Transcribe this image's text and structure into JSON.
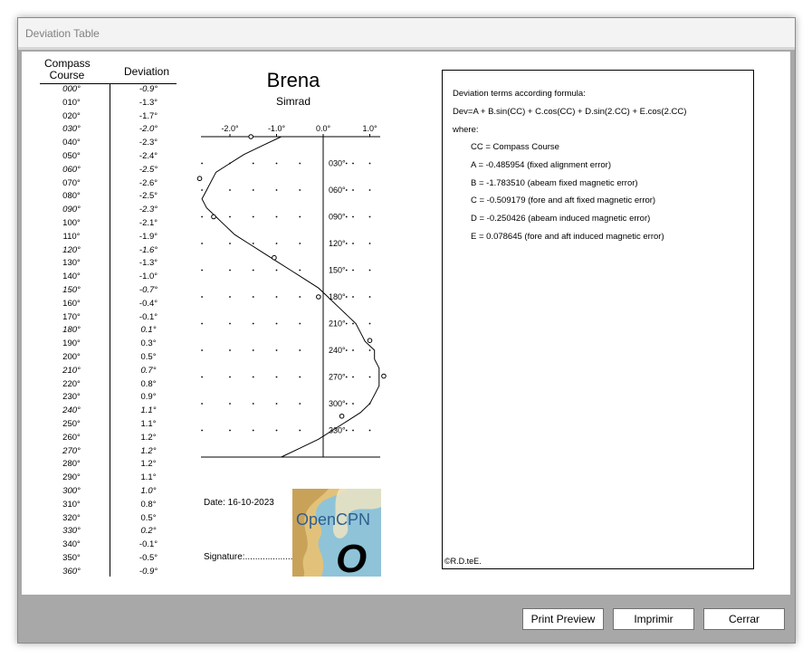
{
  "window": {
    "title": "Deviation Table"
  },
  "table": {
    "header_course": "Compass Course",
    "header_deviation": "Deviation",
    "rows": [
      {
        "cc": "000°",
        "dev": "-0.9°",
        "italic": true
      },
      {
        "cc": "010°",
        "dev": "-1.3°",
        "italic": false
      },
      {
        "cc": "020°",
        "dev": "-1.7°",
        "italic": false
      },
      {
        "cc": "030°",
        "dev": "-2.0°",
        "italic": true
      },
      {
        "cc": "040°",
        "dev": "-2.3°",
        "italic": false
      },
      {
        "cc": "050°",
        "dev": "-2.4°",
        "italic": false
      },
      {
        "cc": "060°",
        "dev": "-2.5°",
        "italic": true
      },
      {
        "cc": "070°",
        "dev": "-2.6°",
        "italic": false
      },
      {
        "cc": "080°",
        "dev": "-2.5°",
        "italic": false
      },
      {
        "cc": "090°",
        "dev": "-2.3°",
        "italic": true
      },
      {
        "cc": "100°",
        "dev": "-2.1°",
        "italic": false
      },
      {
        "cc": "110°",
        "dev": "-1.9°",
        "italic": false
      },
      {
        "cc": "120°",
        "dev": "-1.6°",
        "italic": true
      },
      {
        "cc": "130°",
        "dev": "-1.3°",
        "italic": false
      },
      {
        "cc": "140°",
        "dev": "-1.0°",
        "italic": false
      },
      {
        "cc": "150°",
        "dev": "-0.7°",
        "italic": true
      },
      {
        "cc": "160°",
        "dev": "-0.4°",
        "italic": false
      },
      {
        "cc": "170°",
        "dev": "-0.1°",
        "italic": false
      },
      {
        "cc": "180°",
        "dev": "0.1°",
        "italic": true
      },
      {
        "cc": "190°",
        "dev": "0.3°",
        "italic": false
      },
      {
        "cc": "200°",
        "dev": "0.5°",
        "italic": false
      },
      {
        "cc": "210°",
        "dev": "0.7°",
        "italic": true
      },
      {
        "cc": "220°",
        "dev": "0.8°",
        "italic": false
      },
      {
        "cc": "230°",
        "dev": "0.9°",
        "italic": false
      },
      {
        "cc": "240°",
        "dev": "1.1°",
        "italic": true
      },
      {
        "cc": "250°",
        "dev": "1.1°",
        "italic": false
      },
      {
        "cc": "260°",
        "dev": "1.2°",
        "italic": false
      },
      {
        "cc": "270°",
        "dev": "1.2°",
        "italic": true
      },
      {
        "cc": "280°",
        "dev": "1.2°",
        "italic": false
      },
      {
        "cc": "290°",
        "dev": "1.1°",
        "italic": false
      },
      {
        "cc": "300°",
        "dev": "1.0°",
        "italic": true
      },
      {
        "cc": "310°",
        "dev": "0.8°",
        "italic": false
      },
      {
        "cc": "320°",
        "dev": "0.5°",
        "italic": false
      },
      {
        "cc": "330°",
        "dev": "0.2°",
        "italic": true
      },
      {
        "cc": "340°",
        "dev": "-0.1°",
        "italic": false
      },
      {
        "cc": "350°",
        "dev": "-0.5°",
        "italic": false
      },
      {
        "cc": "360°",
        "dev": "-0.9°",
        "italic": true
      }
    ]
  },
  "ship": {
    "name": "Brena",
    "compass": "Simrad"
  },
  "chart_data": {
    "type": "line",
    "x_tick_labels": [
      "-2.0°",
      "-1.0°",
      "0.0°",
      "1.0°"
    ],
    "x_ticks": [
      -2.0,
      -1.0,
      0.0,
      1.0
    ],
    "y_tick_labels": [
      "030°",
      "060°",
      "090°",
      "120°",
      "150°",
      "180°",
      "210°",
      "240°",
      "270°",
      "300°",
      "330°"
    ],
    "y_ticks": [
      30,
      60,
      90,
      120,
      150,
      180,
      210,
      240,
      270,
      300,
      330
    ],
    "xlim": [
      -2.6,
      1.2
    ],
    "ylim": [
      0,
      360
    ],
    "curve_x": [
      0,
      10,
      20,
      30,
      40,
      50,
      60,
      70,
      80,
      90,
      100,
      110,
      120,
      130,
      140,
      150,
      160,
      170,
      180,
      190,
      200,
      210,
      220,
      230,
      240,
      250,
      260,
      270,
      280,
      290,
      300,
      310,
      320,
      330,
      340,
      350,
      360
    ],
    "curve_y": [
      -0.9,
      -1.3,
      -1.7,
      -2.0,
      -2.3,
      -2.4,
      -2.5,
      -2.6,
      -2.5,
      -2.3,
      -2.1,
      -1.9,
      -1.6,
      -1.3,
      -1.0,
      -0.7,
      -0.4,
      -0.1,
      0.1,
      0.3,
      0.5,
      0.7,
      0.8,
      0.9,
      1.1,
      1.1,
      1.2,
      1.2,
      1.2,
      1.1,
      1.0,
      0.8,
      0.5,
      0.2,
      -0.1,
      -0.5,
      -0.9
    ],
    "observed_points": [
      {
        "course": 0,
        "dev": -1.55
      },
      {
        "course": 47,
        "dev": -2.65
      },
      {
        "course": 90,
        "dev": -2.35
      },
      {
        "course": 136,
        "dev": -1.05
      },
      {
        "course": 180,
        "dev": -0.1
      },
      {
        "course": 229,
        "dev": 1.0
      },
      {
        "course": 269,
        "dev": 1.3
      },
      {
        "course": 314,
        "dev": 0.4
      }
    ],
    "grid": true
  },
  "footer": {
    "date": "Date: 16-10-2023",
    "signature": "Signature:...................................",
    "logo_text": "OpenCPN",
    "logo_letter": "O"
  },
  "formula": {
    "lines": [
      "Deviation terms according formula:",
      "Dev=A + B.sin(CC) + C.cos(CC) + D.sin(2.CC) + E.cos(2.CC)",
      "where:",
      "CC = Compass Course",
      "A = -0.485954 (fixed alignment error)",
      "B = -1.783510 (abeam fixed magnetic error)",
      "C = -0.509179 (fore and aft fixed magnetic error)",
      "D = -0.250426 (abeam induced magnetic error)",
      "E = 0.078645 (fore and aft induced magnetic error)"
    ],
    "copyright": "©R.D.teE."
  },
  "buttons": {
    "preview": "Print Preview",
    "print": "Imprimir",
    "close": "Cerrar"
  }
}
